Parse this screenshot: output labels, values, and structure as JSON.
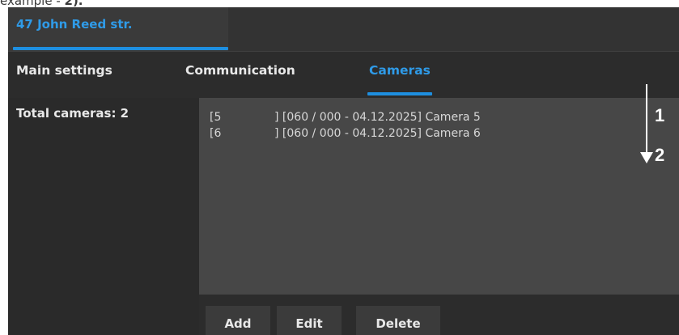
{
  "caption": {
    "prefix": "example - ",
    "value": "2)."
  },
  "window": {
    "title": "47 John Reed str."
  },
  "tabs": [
    {
      "label": "Main settings",
      "active": false
    },
    {
      "label": "Communication",
      "active": false
    },
    {
      "label": "Cameras",
      "active": true
    }
  ],
  "cameras": {
    "total_label": "Total cameras: 2",
    "items": [
      {
        "id": "[5",
        "info": "] [060 / 000 - 04.12.2025]  Camera 5"
      },
      {
        "id": "[6",
        "info": "] [060 / 000 - 04.12.2025]  Camera 6"
      }
    ]
  },
  "annotation": {
    "marker_1": "1",
    "marker_2": "2"
  },
  "buttons": {
    "add": "Add",
    "edit": "Edit",
    "delete": "Delete"
  },
  "colors": {
    "accent": "#1e8fe0",
    "background": "#2b2b2b",
    "list_background": "#474747"
  }
}
